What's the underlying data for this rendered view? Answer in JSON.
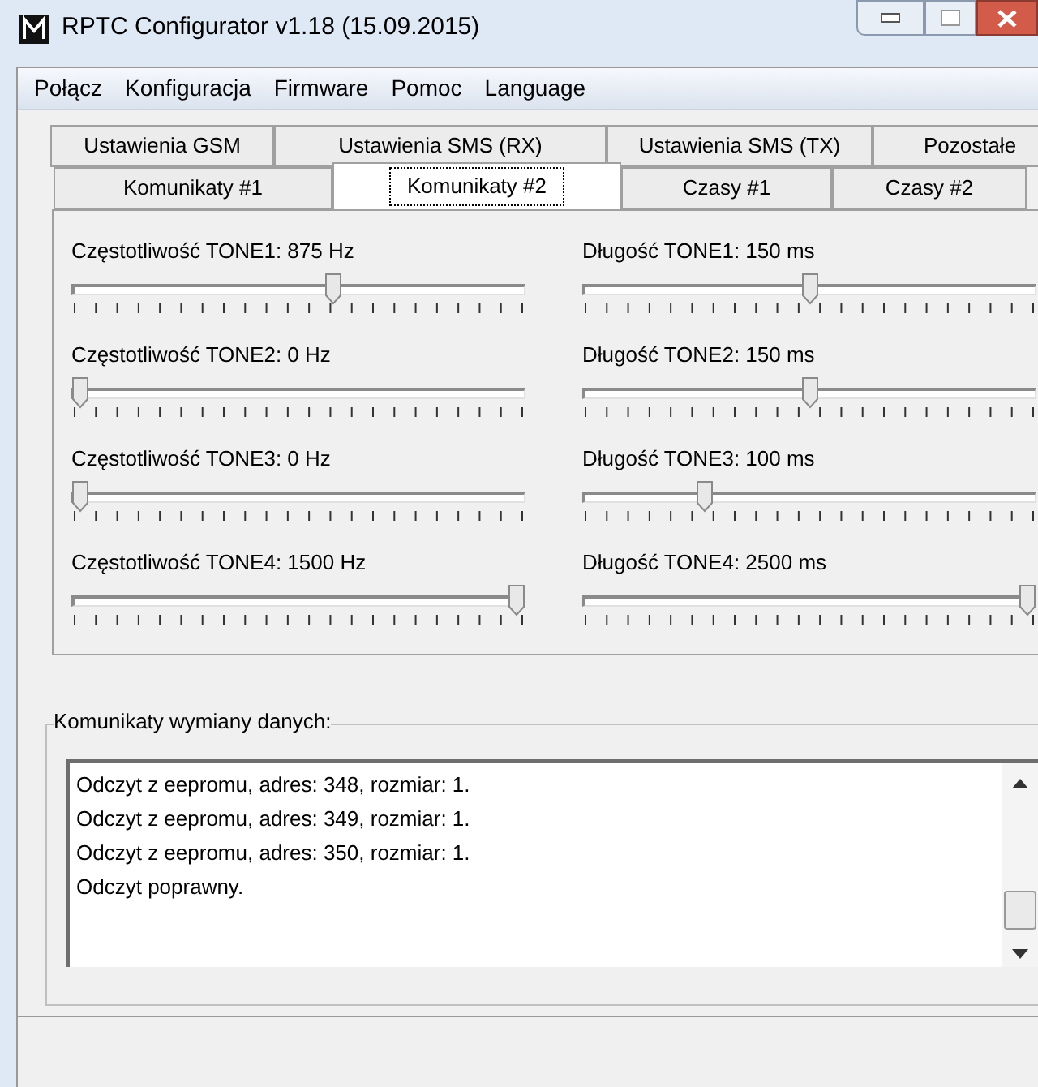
{
  "window": {
    "title": "RPTC Configurator v1.18 (15.09.2015)"
  },
  "menu": [
    "Połącz",
    "Konfiguracja",
    "Firmware",
    "Pomoc",
    "Language"
  ],
  "tab_rows": [
    {
      "tabs": [
        {
          "label": "Ustawienia GSM",
          "selected": false
        },
        {
          "label": "Ustawienia SMS (RX)",
          "selected": false
        },
        {
          "label": "Ustawienia SMS (TX)",
          "selected": false
        },
        {
          "label": "Pozostałe",
          "selected": false
        }
      ]
    },
    {
      "tabs": [
        {
          "label": "Komunikaty #1",
          "selected": false
        },
        {
          "label": "Komunikaty #2",
          "selected": true
        },
        {
          "label": "Czasy #1",
          "selected": false
        },
        {
          "label": "Czasy #2",
          "selected": false
        }
      ]
    }
  ],
  "frequency_sliders": [
    {
      "label": "Częstotliwość TONE1: 875 Hz",
      "level": 0.58
    },
    {
      "label": "Częstotliwość TONE2: 0 Hz",
      "level": 0
    },
    {
      "label": "Częstotliwość TONE3: 0 Hz",
      "level": 0
    },
    {
      "label": "Częstotliwość TONE4: 1500 Hz",
      "level": 1
    }
  ],
  "duration_sliders": [
    {
      "label": "Długość TONE1: 150 ms",
      "level": 0.5
    },
    {
      "label": "Długość TONE2: 150 ms",
      "level": 0.5
    },
    {
      "label": "Długość TONE3: 100 ms",
      "level": 0.26
    },
    {
      "label": "Długość TONE4: 2500 ms",
      "level": 1
    }
  ],
  "log": {
    "title": "Komunikaty wymiany danych:",
    "lines": [
      "Odczyt z eepromu, adres: 348, rozmiar: 1.",
      "Odczyt z eepromu, adres: 349, rozmiar: 1.",
      "Odczyt z eepromu, adres: 350, rozmiar: 1.",
      "Odczyt poprawny."
    ]
  }
}
